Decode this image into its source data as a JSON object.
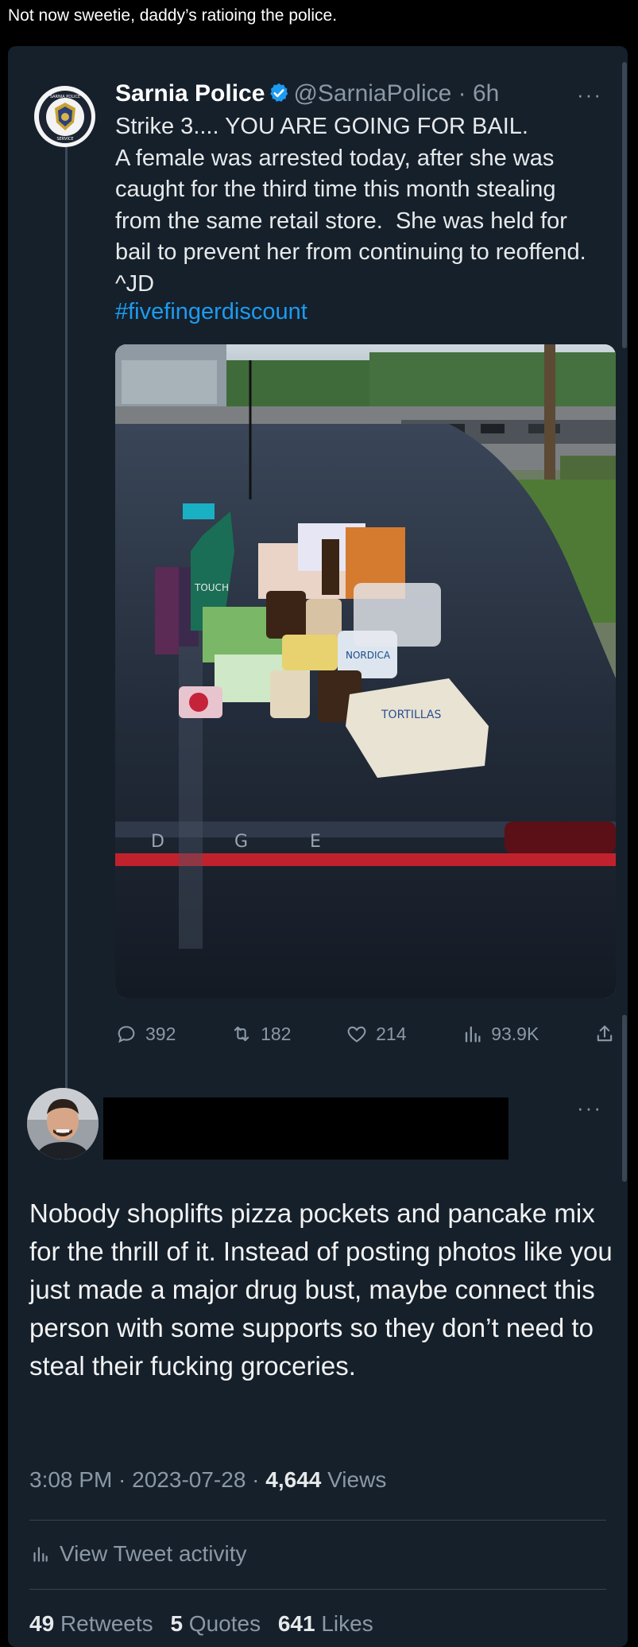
{
  "caption": "Not now sweetie, daddy’s ratioing the police.",
  "quoted_tweet": {
    "avatar_text": [
      "SARNIA POLICE",
      "SERVICE"
    ],
    "name": "Sarnia Police",
    "handle_time": "@SarniaPolice · 6h",
    "more": "···",
    "text": "Strike 3.... YOU ARE GOING FOR BAIL.\nA female was arrested today, after she was caught for the third time this month stealing from the same retail store.  She was held for bail to prevent her from continuing to reoffend. ^JD",
    "hashtag": "#fivefingerdiscount",
    "photo_labels": {
      "touch": "TOUCH",
      "tortillas": "TORTILLAS",
      "nordica": "NORDICA",
      "trunk_letters": [
        "D",
        "G",
        "E"
      ]
    },
    "actions": {
      "replies": "392",
      "retweets": "182",
      "likes": "214",
      "views": "93.9K"
    },
    "colors": {
      "accent": "#1d9bf0",
      "background": "#15202b"
    }
  },
  "reply": {
    "more": "···",
    "text": "Nobody shoplifts pizza pockets and pancake mix for the thrill of it. Instead of posting photos like you just made a major drug bust, maybe connect this person with some supports so they don’t need to steal their fucking groceries.",
    "time": "3:08 PM · 2023-07-28 · ",
    "views_count": "4,644",
    "views_label": " Views",
    "activity_label": "View Tweet activity",
    "retweets_count": "49",
    "retweets_label": "Retweets",
    "quotes_count": "5",
    "quotes_label": "Quotes",
    "likes_count": "641",
    "likes_label": "Likes"
  }
}
